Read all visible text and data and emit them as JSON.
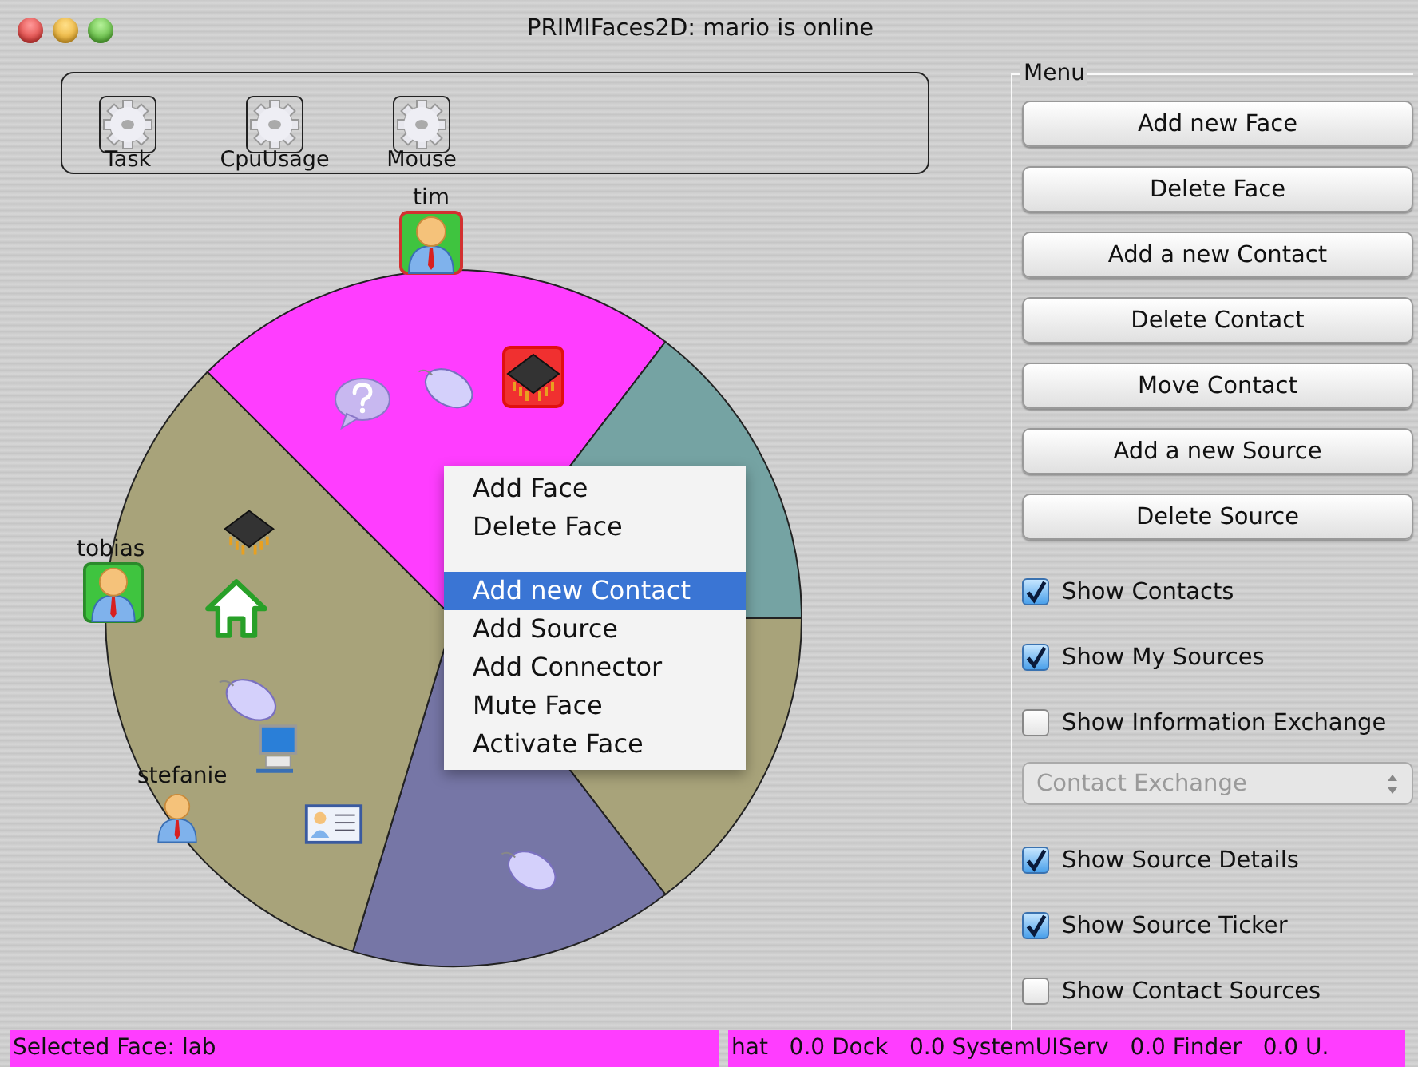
{
  "window": {
    "title": "PRIMIFaces2D: mario is online"
  },
  "toolbar": [
    {
      "label": "Task"
    },
    {
      "label": "CpuUsage"
    },
    {
      "label": "Mouse"
    }
  ],
  "faces": [
    {
      "color": "#ff3dff"
    },
    {
      "color": "#75a3a3"
    },
    {
      "color": "#a8a37a"
    },
    {
      "color": "#7676a6"
    },
    {
      "color": "#a8a37a"
    }
  ],
  "contacts": [
    {
      "name": "tim",
      "highlighted": true,
      "selected": true
    },
    {
      "name": "tobias",
      "highlighted": true,
      "selected": false
    },
    {
      "name": "stefanie",
      "highlighted": false,
      "selected": false
    }
  ],
  "sources": [
    {
      "kind": "question",
      "selected": false
    },
    {
      "kind": "mouse",
      "selected": false
    },
    {
      "kind": "chip",
      "selected": true
    },
    {
      "kind": "chip",
      "selected": false
    },
    {
      "kind": "home",
      "selected": false
    },
    {
      "kind": "mouse",
      "selected": false
    },
    {
      "kind": "computer",
      "selected": false
    },
    {
      "kind": "card",
      "selected": false
    },
    {
      "kind": "mouse",
      "selected": false
    }
  ],
  "context_menu": {
    "groups": [
      [
        {
          "label": "Add Face",
          "selected": false
        },
        {
          "label": "Delete Face",
          "selected": false
        }
      ],
      [
        {
          "label": "Add new Contact",
          "selected": true
        },
        {
          "label": "Add Source",
          "selected": false
        },
        {
          "label": "Add Connector",
          "selected": false
        },
        {
          "label": "Mute Face",
          "selected": false
        },
        {
          "label": "Activate Face",
          "selected": false
        }
      ]
    ]
  },
  "menu_panel": {
    "title": "Menu",
    "controls": [
      {
        "kind": "button",
        "label": "Add new Face"
      },
      {
        "kind": "button",
        "label": "Delete Face"
      },
      {
        "kind": "button",
        "label": "Add a new Contact"
      },
      {
        "kind": "button",
        "label": "Delete Contact"
      },
      {
        "kind": "button",
        "label": "Move Contact"
      },
      {
        "kind": "button",
        "label": "Add a new Source"
      },
      {
        "kind": "button",
        "label": "Delete Source"
      },
      {
        "kind": "checkbox",
        "label": "Show Contacts",
        "checked": true
      },
      {
        "kind": "checkbox",
        "label": "Show My Sources",
        "checked": true
      },
      {
        "kind": "checkbox",
        "label": "Show Information Exchange",
        "checked": false
      },
      {
        "kind": "select",
        "label": "Contact Exchange",
        "disabled": true
      },
      {
        "kind": "checkbox",
        "label": "Show Source Details",
        "checked": true
      },
      {
        "kind": "checkbox",
        "label": "Show Source Ticker",
        "checked": true
      },
      {
        "kind": "checkbox",
        "label": "Show Contact Sources",
        "checked": false
      }
    ]
  },
  "status_bar": {
    "left": "Selected Face: lab",
    "right": "hat   0.0 Dock   0.0 SystemUIServ   0.0 Finder   0.0 U."
  }
}
